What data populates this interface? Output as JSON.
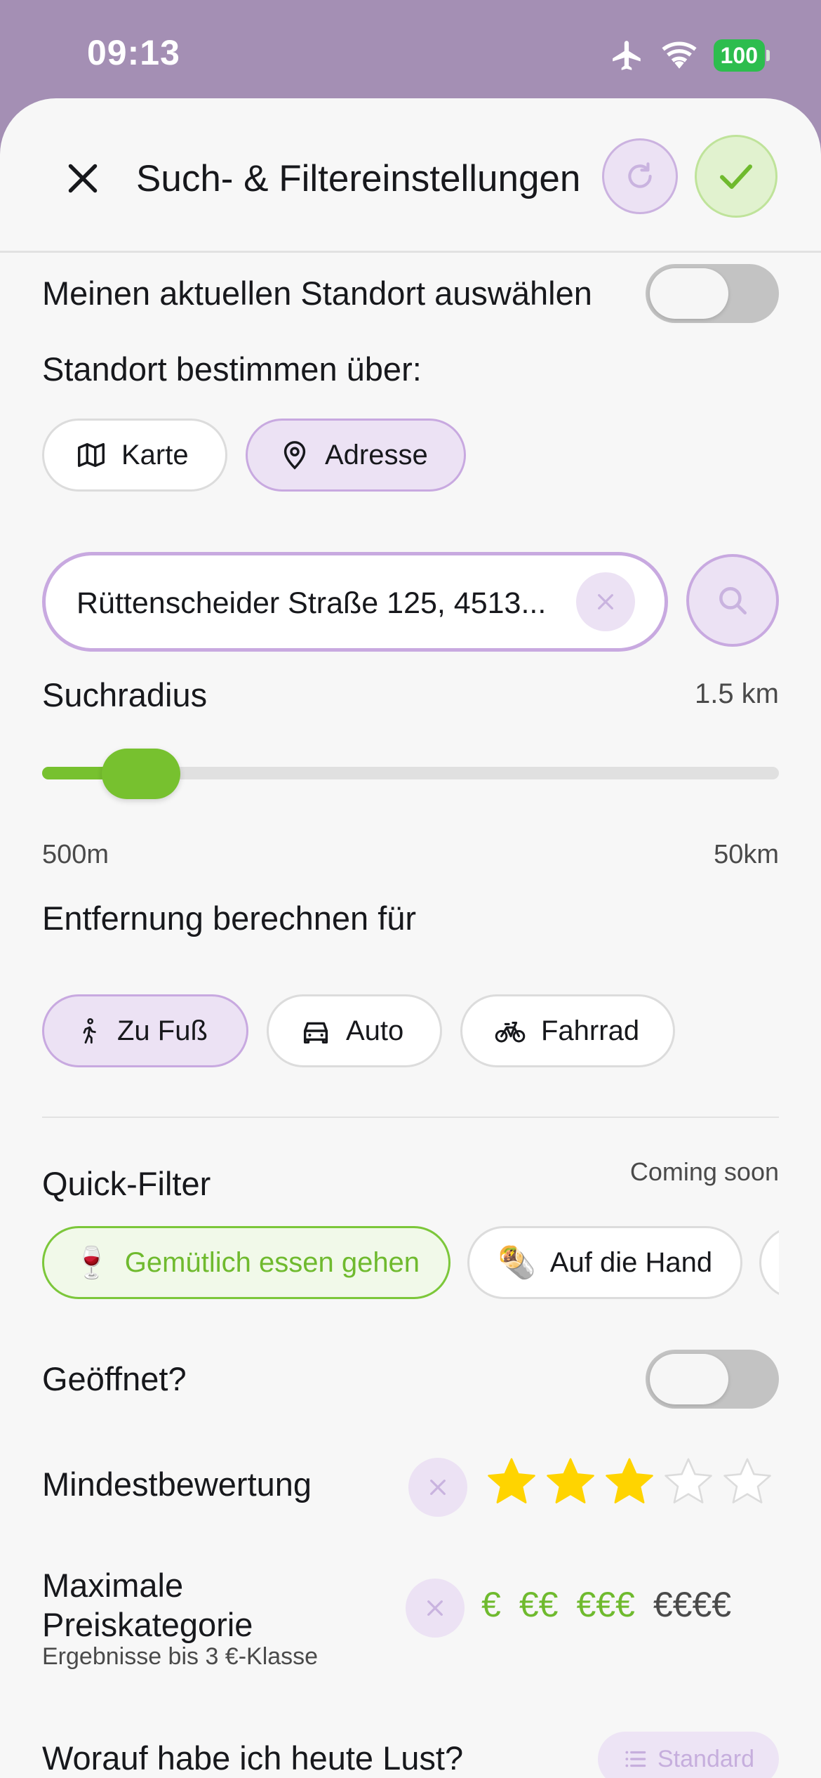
{
  "status_bar": {
    "time": "09:13",
    "battery": "100"
  },
  "header": {
    "title": "Such- & Filtereinstellungen"
  },
  "location": {
    "current_location_label": "Meinen aktuellen Standort auswählen",
    "current_location_on": false,
    "determine_via_label": "Standort bestimmen über:",
    "modes": [
      {
        "label": "Karte",
        "icon": "map-icon",
        "selected": false
      },
      {
        "label": "Adresse",
        "icon": "map-pin-icon",
        "selected": true
      }
    ],
    "address_value": "Rüttenscheider Straße 125, 4513..."
  },
  "radius": {
    "label": "Suchradius",
    "value": "1.5 km",
    "min_label": "500m",
    "max_label": "50km",
    "fraction": 0.1
  },
  "distance": {
    "label": "Entfernung berechnen für",
    "modes": [
      {
        "label": "Zu Fuß",
        "icon": "walking-icon",
        "selected": true
      },
      {
        "label": "Auto",
        "icon": "car-icon",
        "selected": false
      },
      {
        "label": "Fahrrad",
        "icon": "bicycle-icon",
        "selected": false
      }
    ]
  },
  "quick_filter": {
    "label": "Quick-Filter",
    "note": "Coming soon",
    "items": [
      {
        "label": "Gemütlich essen gehen",
        "emoji": "🍷",
        "selected": true
      },
      {
        "label": "Auf die Hand",
        "emoji": "🌯",
        "selected": false
      }
    ]
  },
  "open_now": {
    "label": "Geöffnet?",
    "on": false
  },
  "rating": {
    "label": "Mindestbewertung",
    "value": 3,
    "max": 5
  },
  "price": {
    "label_line1": "Maximale",
    "label_line2": "Preiskategorie",
    "sub_label": "Ergebnisse bis 3 €-Klasse",
    "levels": [
      "€",
      "€€",
      "€€€",
      "€€€€"
    ],
    "selected_level": 3
  },
  "cravings": {
    "label": "Worauf habe ich heute Lust?",
    "standard_label": "Standard"
  },
  "colors": {
    "accent_purple": "#c8a9e0",
    "accent_green": "#77c12f",
    "status_bar_bg": "#a48fb4",
    "star_yellow": "#ffd400"
  }
}
